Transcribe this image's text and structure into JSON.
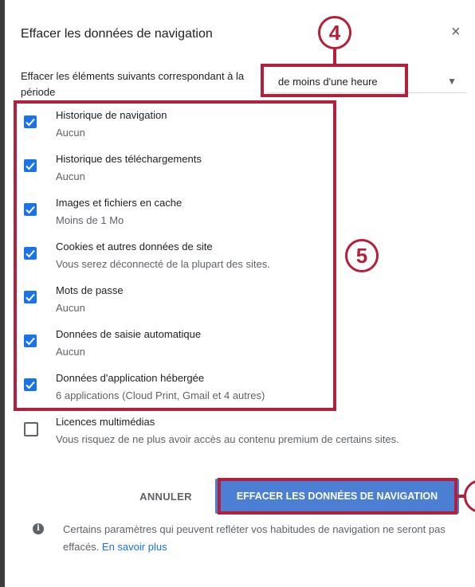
{
  "dialog": {
    "title": "Effacer les données de navigation",
    "close_symbol": "×"
  },
  "period": {
    "label": "Effacer les éléments suivants correspondant à la période",
    "selected": "de moins d'une heure",
    "arrow_symbol": "▼"
  },
  "items": [
    {
      "name": "Historique de navigation",
      "desc": "Aucun",
      "checked": true
    },
    {
      "name": "Historique des téléchargements",
      "desc": "Aucun",
      "checked": true
    },
    {
      "name": "Images et fichiers en cache",
      "desc": "Moins de 1 Mo",
      "checked": true
    },
    {
      "name": "Cookies et autres données de site",
      "desc": "Vous serez déconnecté de la plupart des sites.",
      "checked": true
    },
    {
      "name": "Mots de passe",
      "desc": "Aucun",
      "checked": true
    },
    {
      "name": "Données de saisie automatique",
      "desc": "Aucun",
      "checked": true
    },
    {
      "name": "Données d'application hébergée",
      "desc": "6 applications (Cloud Print, Gmail et 4 autres)",
      "checked": true
    },
    {
      "name": "Licences multimédias",
      "desc": "Vous risquez de ne plus avoir accès au contenu premium de certains sites.",
      "checked": false
    }
  ],
  "buttons": {
    "cancel": "ANNULER",
    "clear": "EFFACER LES DONNÉES DE NAVIGATION"
  },
  "info": {
    "icon_symbol": "i",
    "text": "Certains paramètres qui peuvent refléter vos habitudes de navigation ne seront pas effacés.",
    "link": "En savoir plus"
  },
  "annotations": {
    "four": "4",
    "five": "5",
    "color": "#b2203b"
  },
  "colors": {
    "accent": "#1a73e8",
    "clear_button": "#4a7fd4"
  }
}
